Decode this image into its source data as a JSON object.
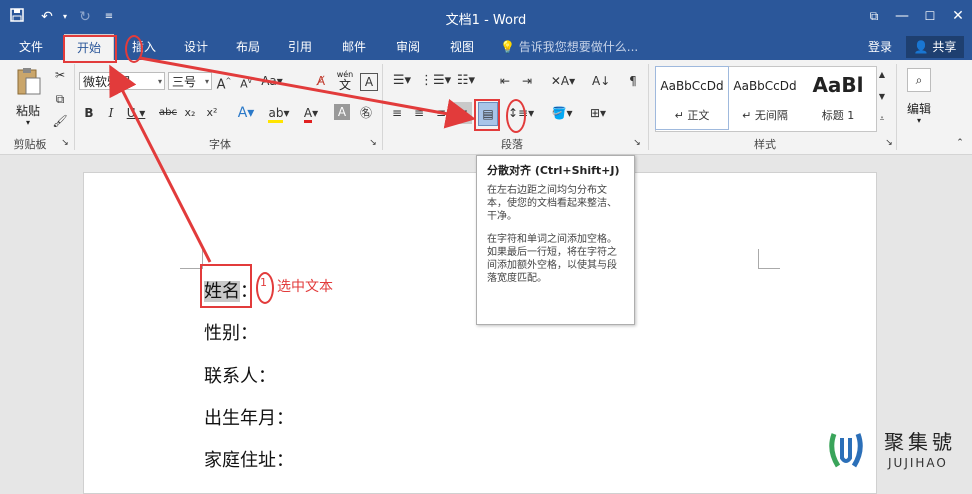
{
  "window": {
    "title": "文档1 - Word",
    "quick_access": {
      "save_icon": "save-icon",
      "undo_icon": "undo-icon",
      "redo_icon": "redo-icon",
      "customize_icon": "customize-icon"
    },
    "controls": {
      "ribbon_display": "ribbon-display-icon",
      "minimize": "—",
      "maximize": "☐",
      "close": "✕"
    }
  },
  "tabs": [
    "文件",
    "开始",
    "插入",
    "设计",
    "布局",
    "引用",
    "邮件",
    "审阅",
    "视图"
  ],
  "active_tab": "开始",
  "tell_me": "告诉我您想要做什么...",
  "login": "登录",
  "share": "共享",
  "ribbon": {
    "clipboard": {
      "paste": "粘贴",
      "label": "剪贴板"
    },
    "font": {
      "name": "微软雅黑",
      "size": "三号",
      "label": "字体",
      "wen": "wén",
      "wen_sub": "文"
    },
    "paragraph": {
      "label": "段落"
    },
    "styles": {
      "label": "样式",
      "items": [
        {
          "sample": "AaBbCcDd",
          "name": "↵ 正文"
        },
        {
          "sample": "AaBbCcDd",
          "name": "↵ 无间隔"
        },
        {
          "sample": "AaBl",
          "name": "标题 1"
        }
      ]
    },
    "editing": {
      "label": "编辑"
    }
  },
  "tooltip": {
    "title": "分散对齐 (Ctrl+Shift+J)",
    "p1": "在左右边距之间均匀分布文本，使您的文档看起来整洁、干净。",
    "p2": "在字符和单词之间添加空格。如果最后一行短，将在字符之间添加额外空格，以使其与段落宽度匹配。"
  },
  "document": {
    "lines": [
      "姓名：",
      "性别：",
      "联系人：",
      "出生年月：",
      "家庭住址："
    ],
    "selected_text": "姓名"
  },
  "annotation": {
    "step_number": "1",
    "note": "选中文本"
  },
  "watermark": {
    "cn": "聚集號",
    "en": "JUJIHAO"
  },
  "colors": {
    "word_blue": "#2b579a",
    "annotation_red": "#e23b3b",
    "selection_gray": "#c8c8c8"
  }
}
